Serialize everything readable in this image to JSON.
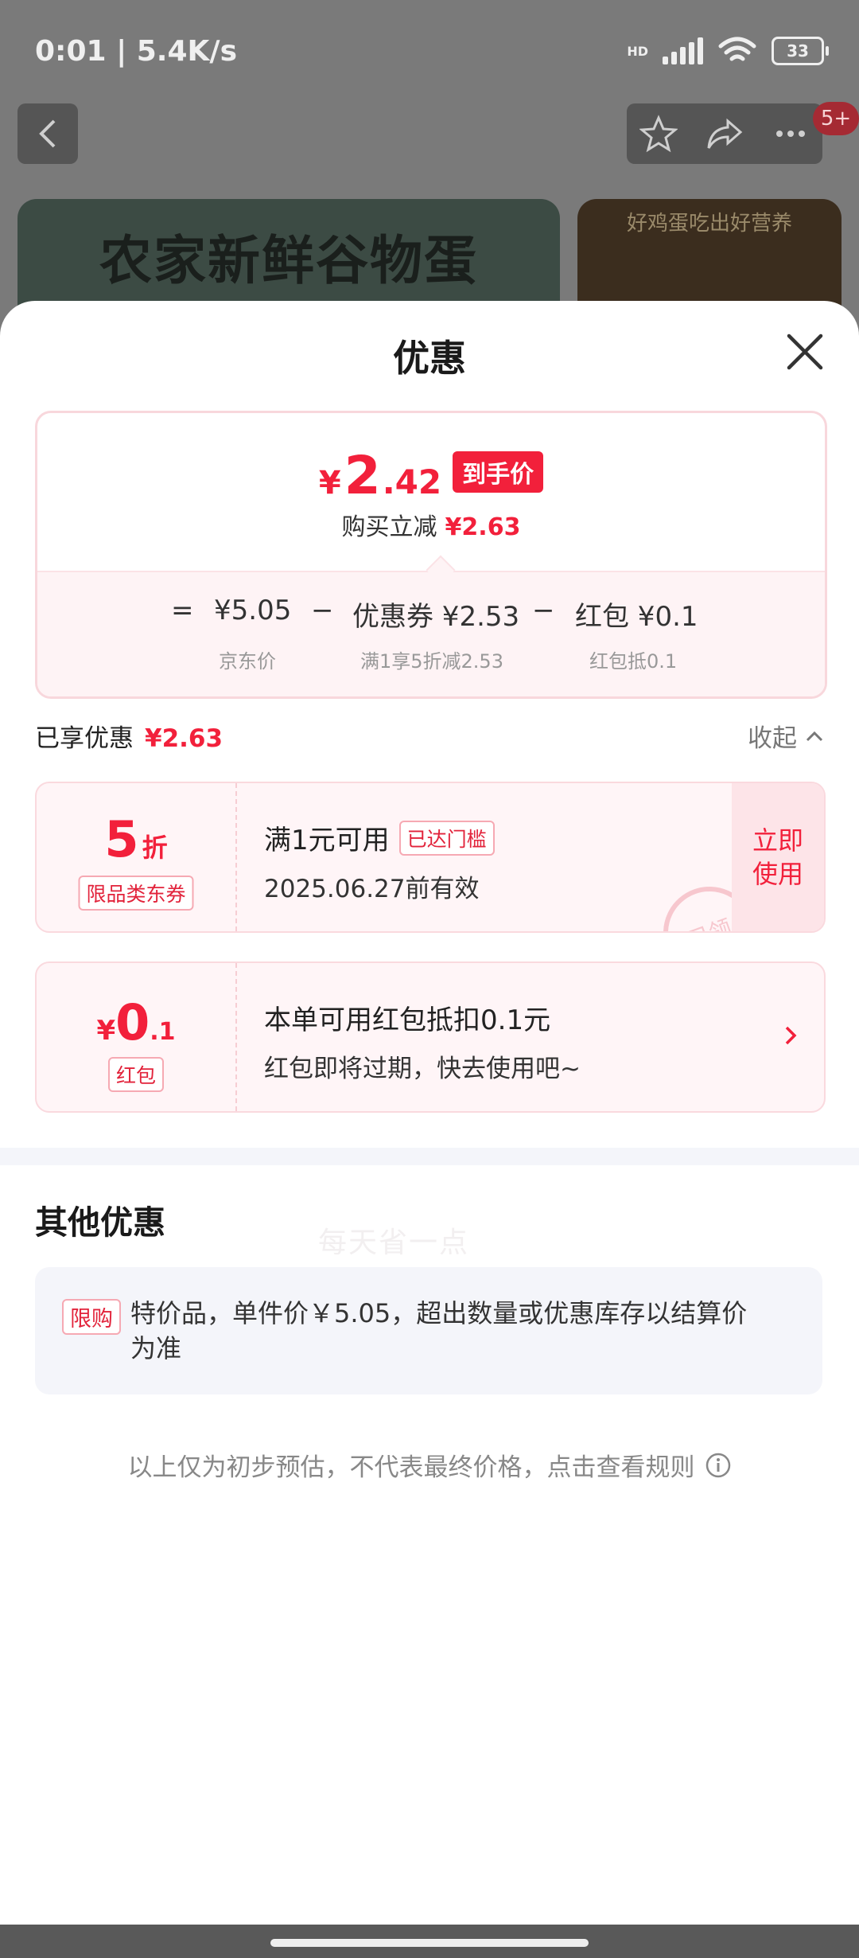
{
  "status_bar": {
    "time_speed": "0:01 | 5.4K/s",
    "network": "HD",
    "battery": "33"
  },
  "top_nav": {
    "cart_badge": "5+"
  },
  "banners": {
    "main_title": "农家新鲜谷物蛋",
    "side_title": "好鸡蛋吃出好营养"
  },
  "sheet": {
    "title": "优惠",
    "price_card": {
      "currency": "¥",
      "price_int": "2",
      "price_dec": ".42",
      "price_tag": "到手价",
      "instant_reduce_label": "购买立减",
      "instant_reduce_value": "¥2.63",
      "formula": {
        "eq": "=",
        "jd_price": "¥5.05",
        "minus1": "−",
        "coupon": "优惠券 ¥2.53",
        "minus2": "−",
        "redpacket": "红包 ¥0.1"
      },
      "notes": {
        "jd_price": "京东价",
        "coupon": "满1享5折减2.53",
        "redpacket": "红包抵0.1"
      }
    },
    "enjoyed_label": "已享优惠",
    "enjoyed_value": "¥2.63",
    "collapse_label": "收起",
    "coupon": {
      "discount": "5",
      "unit": "折",
      "type": "限品类东券",
      "title": "满1元可用",
      "reach_tag": "已达门槛",
      "validity": "2025.06.27前有效",
      "use_button": "立即使用",
      "stamp": "已领",
      "watermark": "每天省一点"
    },
    "redpacket": {
      "currency": "¥",
      "amount_int": "0",
      "amount_dec": ".1",
      "type": "红包",
      "title": "本单可用红包抵扣0.1元",
      "subtitle": "红包即将过期，快去使用吧~"
    },
    "other_title": "其他优惠",
    "other_item": {
      "tag": "限购",
      "text": "特价品，单件价￥5.05，超出数量或优惠库存以结算价为准"
    },
    "disclaimer": "以上仅为初步预估，不代表最终价格，点击查看规则"
  },
  "colors": {
    "accent": "#f2203b",
    "coupon_bg": "#fff5f7"
  }
}
